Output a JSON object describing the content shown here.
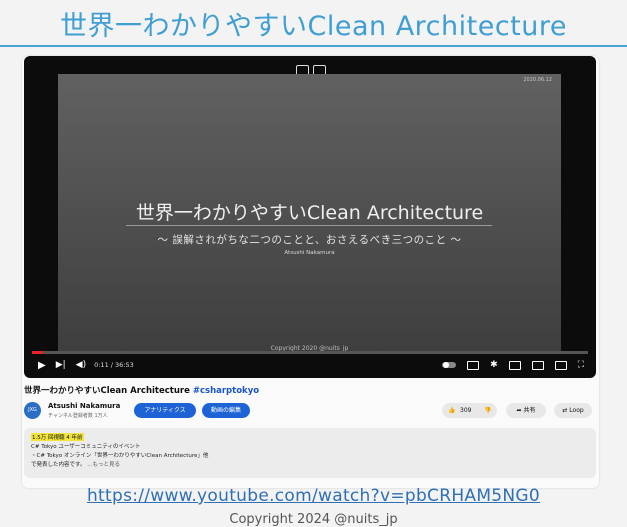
{
  "slide": {
    "title": "世界一わかりやすいClean Architecture",
    "url": "https://www.youtube.com/watch?v=pbCRHAM5NG0",
    "copyright": "Copyright 2024 @nuits_jp"
  },
  "video": {
    "date": "2020.06.12",
    "title": "世界一わかりやすいClean Architecture",
    "subtitle": "～ 誤解されがちな二つのことと、おさえるべき三つのこと ～",
    "author": "Atsushi Nakamura",
    "copyright": "Copyright 2020 @nuits_jp",
    "time": "0:11 / 36:53",
    "progress": 0.02
  },
  "page": {
    "heading": "世界一わかりやすいClean Architecture",
    "hashtag": "#csharptokyo",
    "channel_name": "Atsushi Nakamura",
    "channel_subs": "チャンネル登録者数 1万人",
    "avatar_text": "JXG",
    "analytics_label": "アナリティクス",
    "edit_label": "動画の編集",
    "like_count": "309",
    "share_label": "共有",
    "loop_label": "Loop"
  },
  "description": {
    "meta": "1.5万 回視聴 4 年前",
    "line1": "C# Tokyo ユーザーコミュニティのイベント",
    "line2": "・C# Tokyo オンライン「世界一わかりやすいClean Architecture」他",
    "line3": "で発表した内容です。",
    "more": "...もっと見る"
  }
}
